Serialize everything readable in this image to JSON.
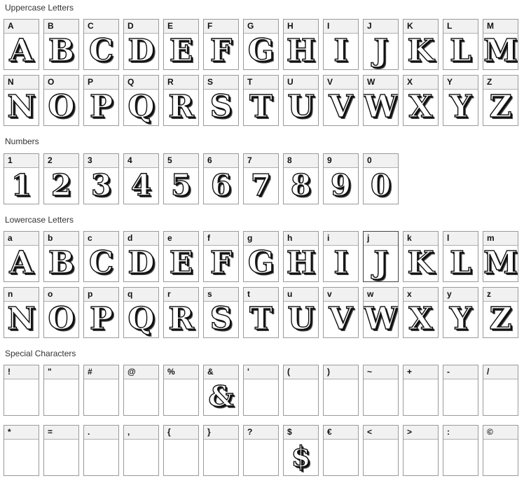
{
  "sections": {
    "uppercase": "Uppercase Letters",
    "numbers": "Numbers",
    "lowercase": "Lowercase Letters",
    "special": "Special Characters"
  },
  "uppercase_row1": [
    {
      "label": "A",
      "glyph": "A"
    },
    {
      "label": "B",
      "glyph": "B"
    },
    {
      "label": "C",
      "glyph": "C"
    },
    {
      "label": "D",
      "glyph": "D"
    },
    {
      "label": "E",
      "glyph": "E"
    },
    {
      "label": "F",
      "glyph": "F"
    },
    {
      "label": "G",
      "glyph": "G"
    },
    {
      "label": "H",
      "glyph": "H"
    },
    {
      "label": "I",
      "glyph": "I"
    },
    {
      "label": "J",
      "glyph": "J"
    },
    {
      "label": "K",
      "glyph": "K"
    },
    {
      "label": "L",
      "glyph": "L"
    },
    {
      "label": "M",
      "glyph": "M"
    }
  ],
  "uppercase_row2": [
    {
      "label": "N",
      "glyph": "N"
    },
    {
      "label": "O",
      "glyph": "O"
    },
    {
      "label": "P",
      "glyph": "P"
    },
    {
      "label": "Q",
      "glyph": "Q"
    },
    {
      "label": "R",
      "glyph": "R"
    },
    {
      "label": "S",
      "glyph": "S"
    },
    {
      "label": "T",
      "glyph": "T"
    },
    {
      "label": "U",
      "glyph": "U"
    },
    {
      "label": "V",
      "glyph": "V"
    },
    {
      "label": "W",
      "glyph": "W"
    },
    {
      "label": "X",
      "glyph": "X"
    },
    {
      "label": "Y",
      "glyph": "Y"
    },
    {
      "label": "Z",
      "glyph": "Z"
    }
  ],
  "numbers_row": [
    {
      "label": "1",
      "glyph": "1"
    },
    {
      "label": "2",
      "glyph": "2"
    },
    {
      "label": "3",
      "glyph": "3"
    },
    {
      "label": "4",
      "glyph": "4"
    },
    {
      "label": "5",
      "glyph": "5"
    },
    {
      "label": "6",
      "glyph": "6"
    },
    {
      "label": "7",
      "glyph": "7"
    },
    {
      "label": "8",
      "glyph": "8"
    },
    {
      "label": "9",
      "glyph": "9"
    },
    {
      "label": "0",
      "glyph": "0"
    }
  ],
  "lowercase_row1": [
    {
      "label": "a",
      "glyph": "A"
    },
    {
      "label": "b",
      "glyph": "B"
    },
    {
      "label": "c",
      "glyph": "C"
    },
    {
      "label": "d",
      "glyph": "D"
    },
    {
      "label": "e",
      "glyph": "E"
    },
    {
      "label": "f",
      "glyph": "F"
    },
    {
      "label": "g",
      "glyph": "G"
    },
    {
      "label": "h",
      "glyph": "H"
    },
    {
      "label": "i",
      "glyph": "I"
    },
    {
      "label": "j",
      "glyph": "J"
    },
    {
      "label": "k",
      "glyph": "K"
    },
    {
      "label": "l",
      "glyph": "L"
    },
    {
      "label": "m",
      "glyph": "M"
    }
  ],
  "lowercase_row2": [
    {
      "label": "n",
      "glyph": "N"
    },
    {
      "label": "o",
      "glyph": "O"
    },
    {
      "label": "p",
      "glyph": "P"
    },
    {
      "label": "q",
      "glyph": "Q"
    },
    {
      "label": "r",
      "glyph": "R"
    },
    {
      "label": "s",
      "glyph": "S"
    },
    {
      "label": "t",
      "glyph": "T"
    },
    {
      "label": "u",
      "glyph": "U"
    },
    {
      "label": "v",
      "glyph": "V"
    },
    {
      "label": "w",
      "glyph": "W"
    },
    {
      "label": "x",
      "glyph": "X"
    },
    {
      "label": "y",
      "glyph": "Y"
    },
    {
      "label": "z",
      "glyph": "Z"
    }
  ],
  "special_row1": [
    {
      "label": "!",
      "glyph": ""
    },
    {
      "label": "\"",
      "glyph": ""
    },
    {
      "label": "#",
      "glyph": ""
    },
    {
      "label": "@",
      "glyph": ""
    },
    {
      "label": "%",
      "glyph": ""
    },
    {
      "label": "&",
      "glyph": "&"
    },
    {
      "label": "'",
      "glyph": ""
    },
    {
      "label": "(",
      "glyph": ""
    },
    {
      "label": ")",
      "glyph": ""
    },
    {
      "label": "~",
      "glyph": ""
    },
    {
      "label": "+",
      "glyph": ""
    },
    {
      "label": "-",
      "glyph": ""
    },
    {
      "label": "/",
      "glyph": ""
    }
  ],
  "special_row2": [
    {
      "label": "*",
      "glyph": ""
    },
    {
      "label": "=",
      "glyph": ""
    },
    {
      "label": ".",
      "glyph": ""
    },
    {
      "label": ",",
      "glyph": ""
    },
    {
      "label": "{",
      "glyph": ""
    },
    {
      "label": "}",
      "glyph": ""
    },
    {
      "label": "?",
      "glyph": ""
    },
    {
      "label": "$",
      "glyph": "$"
    },
    {
      "label": "€",
      "glyph": ""
    },
    {
      "label": "<",
      "glyph": ""
    },
    {
      "label": ">",
      "glyph": ""
    },
    {
      "label": ":",
      "glyph": ""
    },
    {
      "label": "©",
      "glyph": ""
    }
  ]
}
